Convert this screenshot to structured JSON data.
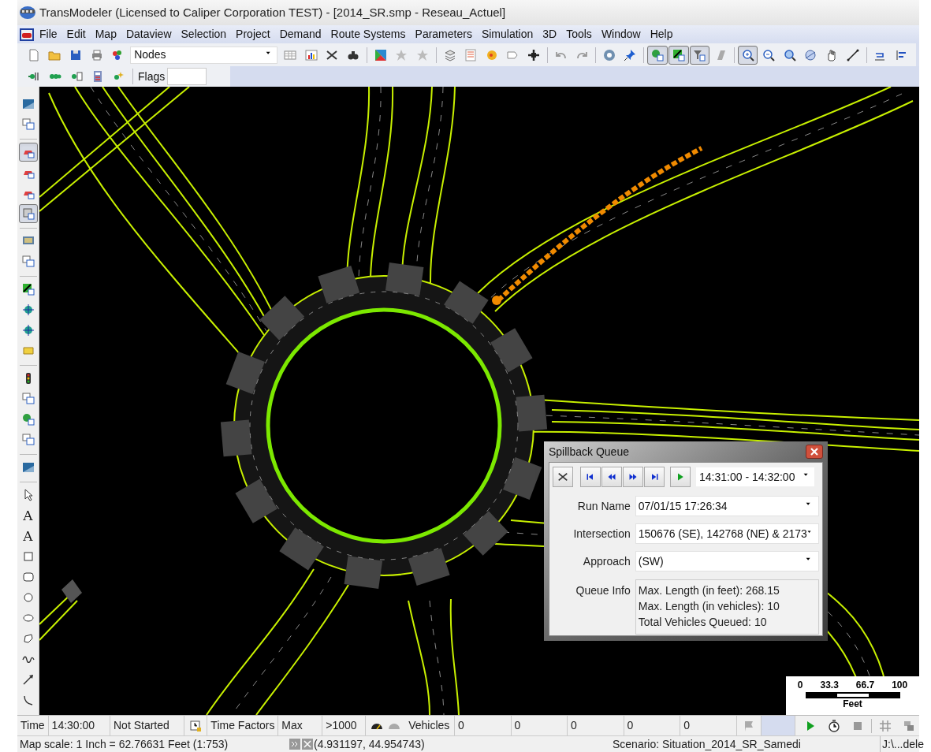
{
  "window": {
    "title": "TransModeler (Licensed to Caliper Corporation TEST) - [2014_SR.smp - Reseau_Actuel]"
  },
  "menu": [
    "File",
    "Edit",
    "Map",
    "Dataview",
    "Selection",
    "Project",
    "Demand",
    "Route Systems",
    "Parameters",
    "Simulation",
    "3D",
    "Tools",
    "Window",
    "Help"
  ],
  "toolbar": {
    "layer": "Nodes",
    "buttons": [
      {
        "pressed": false
      },
      {
        "pressed": false
      },
      {
        "pressed": false
      },
      {
        "pressed": false
      },
      {
        "pressed": false
      },
      {
        "pressed": false
      },
      {
        "pressed": false
      },
      {
        "pressed": false
      },
      {
        "pressed": false
      },
      {
        "pressed": false
      },
      {
        "pressed": false
      },
      {
        "pressed": false
      },
      {
        "pressed": false
      },
      {
        "pressed": false
      },
      {
        "pressed": false
      },
      {
        "pressed": false
      },
      {
        "pressed": false
      },
      {
        "pressed": false
      },
      {
        "pressed": false
      },
      {
        "pressed": false
      },
      {
        "pressed": false
      },
      {
        "pressed": true
      },
      {
        "pressed": true
      },
      {
        "pressed": true
      },
      {
        "pressed": false
      },
      {
        "pressed": true
      },
      {
        "pressed": false
      },
      {
        "pressed": false
      },
      {
        "pressed": false
      },
      {
        "pressed": false
      },
      {
        "pressed": false
      },
      {
        "pressed": false
      },
      {
        "pressed": false
      }
    ]
  },
  "toolbar_2": {
    "buttons": [
      {
        "pressed": false
      },
      {
        "pressed": false
      },
      {
        "pressed": false
      },
      {
        "pressed": false
      },
      {
        "pressed": false
      }
    ],
    "flags_label": "Flags"
  },
  "left_toolbar": [
    {
      "kind": "icon",
      "pressed": false
    },
    {
      "kind": "icon",
      "pressed": false
    },
    {
      "kind": "icon",
      "pressed": true
    },
    {
      "kind": "icon",
      "pressed": false
    },
    {
      "kind": "icon",
      "pressed": false
    },
    {
      "kind": "icon",
      "pressed": true
    },
    {
      "kind": "icon",
      "pressed": false
    },
    {
      "kind": "icon",
      "pressed": false
    },
    {
      "kind": "icon",
      "pressed": false
    },
    {
      "kind": "icon",
      "pressed": false
    },
    {
      "kind": "icon",
      "pressed": false
    },
    {
      "kind": "icon",
      "pressed": false
    },
    {
      "kind": "icon",
      "pressed": false
    },
    {
      "kind": "icon",
      "pressed": false
    },
    {
      "kind": "icon",
      "pressed": false
    },
    {
      "kind": "icon",
      "pressed": false
    },
    {
      "kind": "icon",
      "pressed": false
    },
    {
      "kind": "icon",
      "pressed": false
    },
    {
      "kind": "glyph",
      "glyph": "A",
      "pressed": false
    },
    {
      "kind": "glyph",
      "glyph": "A",
      "pressed": false
    },
    {
      "kind": "icon",
      "pressed": false
    },
    {
      "kind": "icon",
      "pressed": false
    },
    {
      "kind": "icon",
      "pressed": false
    },
    {
      "kind": "icon",
      "pressed": false
    },
    {
      "kind": "icon",
      "pressed": false
    },
    {
      "kind": "icon",
      "pressed": false
    },
    {
      "kind": "icon",
      "pressed": false
    },
    {
      "kind": "icon",
      "pressed": false
    }
  ],
  "scale": {
    "ticks": [
      "0",
      "33.3",
      "66.7",
      "100"
    ],
    "unit": "Feet"
  },
  "dialog": {
    "title": "Spillback Queue",
    "time_range": "14:31:00 - 14:32:00",
    "fields": [
      {
        "label": "Run Name",
        "value": "07/01/15 17:26:34"
      },
      {
        "label": "Intersection",
        "value": "150676 (SE), 142768 (NE) & 2173"
      },
      {
        "label": "Approach",
        "value": "(SW)"
      }
    ],
    "queue_label": "Queue Info",
    "queue_lines": [
      "Max. Length (in feet): 268.15",
      "Max. Length (in vehicles): 10",
      "Total Vehicles Queued: 10"
    ]
  },
  "status_bar": {
    "time_label": "Time",
    "time": "14:30:00",
    "state": "Not Started",
    "time_factors": "Time Factors",
    "speed": "Max",
    "limit": ">1000",
    "vehicles_label": "Vehicles",
    "counts": [
      "0",
      "0",
      "0",
      "0",
      "0"
    ]
  },
  "info_bar": {
    "map_scale": "Map scale: 1 Inch = 62.76631 Feet (1:753)",
    "coordinates": "(4.931197, 44.954743)",
    "scenario": "Scenario: Situation_2014_SR_Samedi",
    "path": "J:\\...dele"
  }
}
